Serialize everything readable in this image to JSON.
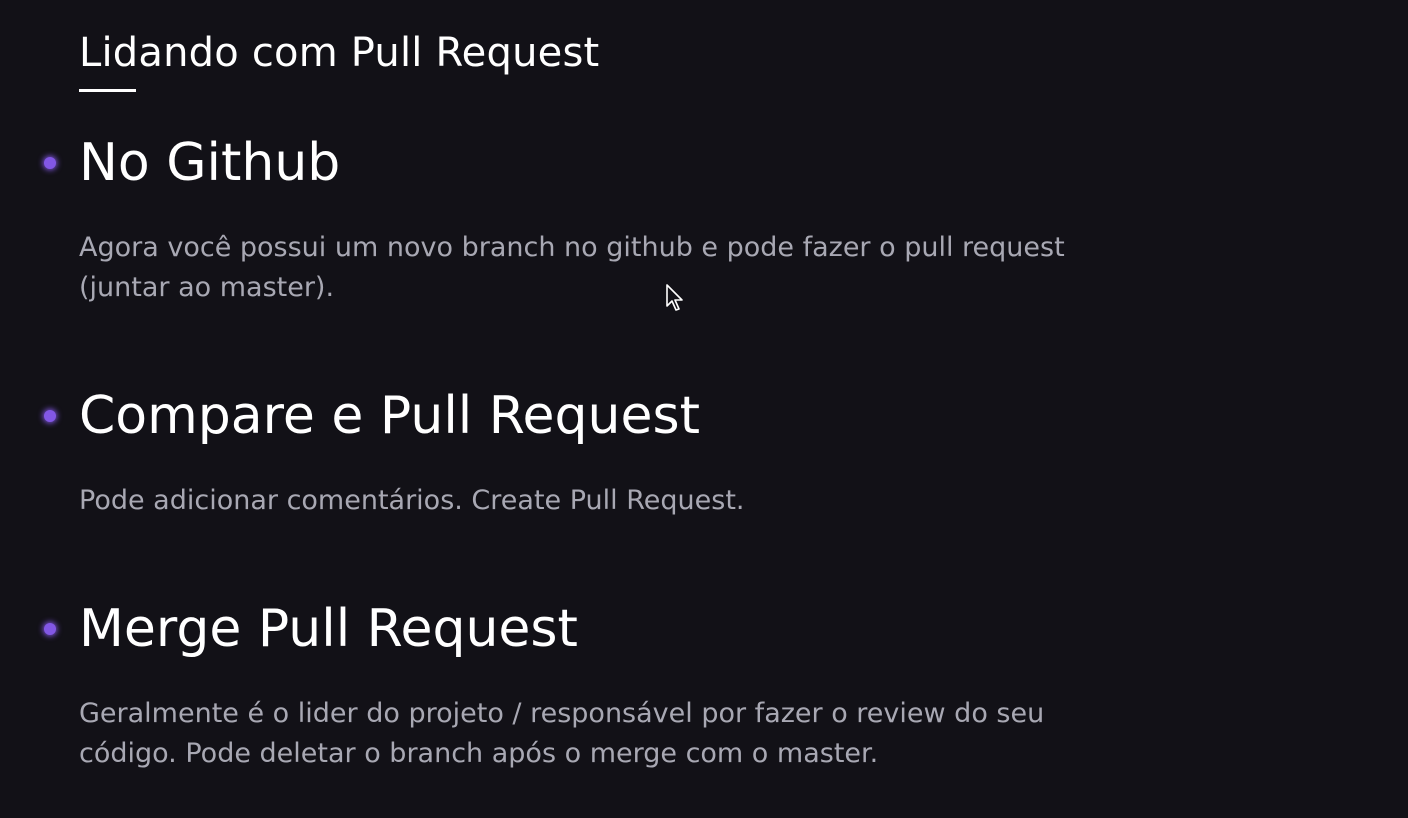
{
  "slide": {
    "title": "Lidando com Pull Request",
    "accent_color": "#8257e5",
    "bullets": [
      {
        "heading": "No Github",
        "text": "Agora você possui um novo branch no github e pode fazer o pull request\n(juntar ao master)."
      },
      {
        "heading": "Compare e Pull Request",
        "text": "Pode adicionar comentários. Create Pull Request."
      },
      {
        "heading": "Merge Pull Request",
        "text": "Geralmente é o lider do projeto / responsável por fazer o review do seu\ncódigo. Pode deletar o branch após o merge com o master."
      }
    ]
  },
  "cursor": {
    "icon": "mouse-pointer-icon"
  }
}
